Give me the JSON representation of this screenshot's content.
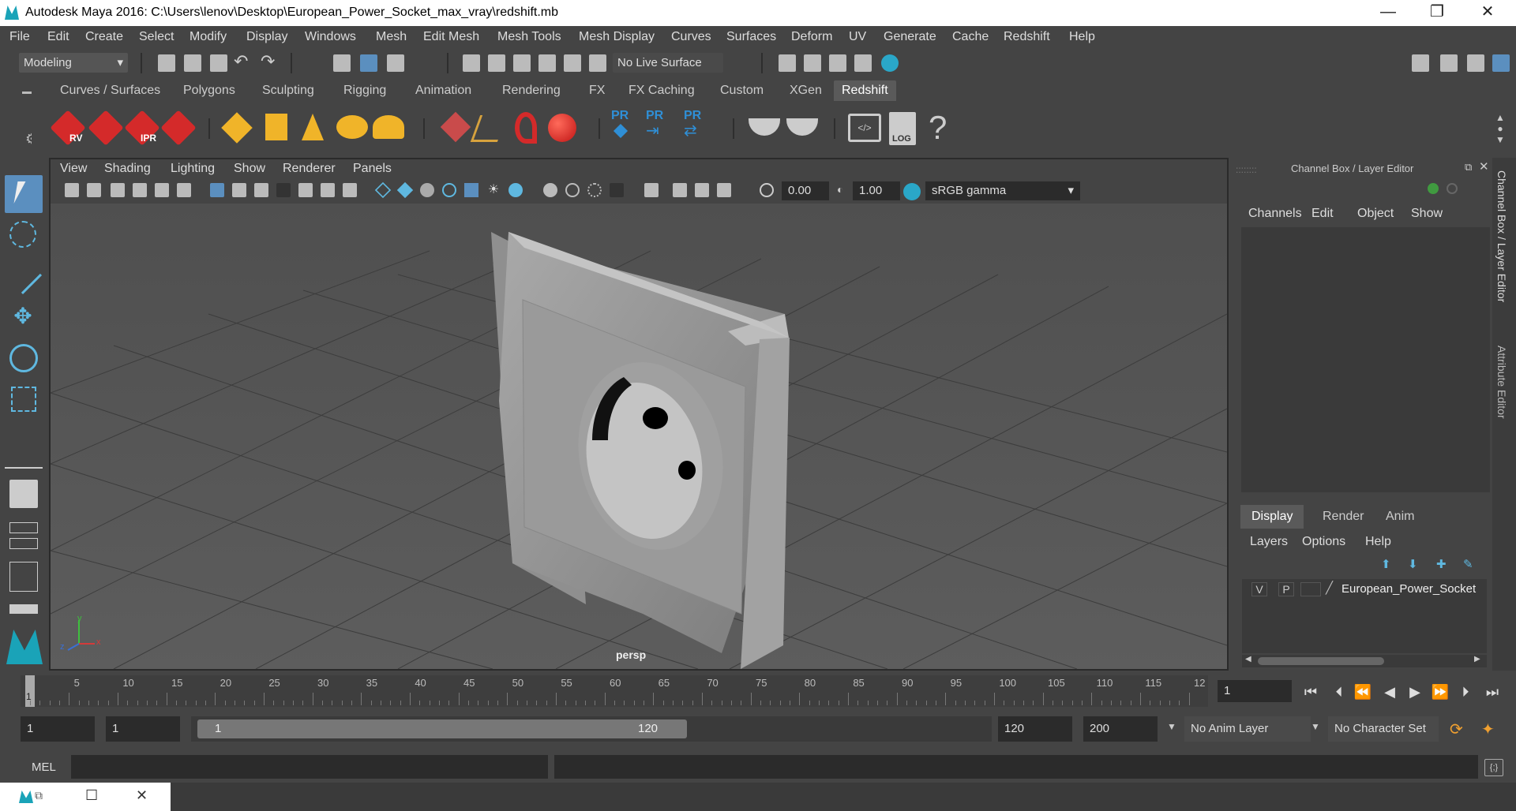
{
  "window": {
    "title": "Autodesk Maya 2016: C:\\Users\\lenov\\Desktop\\European_Power_Socket_max_vray\\redshift.mb",
    "min": "—",
    "max": "❐",
    "close": "✕"
  },
  "menubar": [
    "File",
    "Edit",
    "Create",
    "Select",
    "Modify",
    "Display",
    "Windows",
    "Mesh",
    "Edit Mesh",
    "Mesh Tools",
    "Mesh Display",
    "Curves",
    "Surfaces",
    "Deform",
    "UV",
    "Generate",
    "Cache",
    "Redshift",
    "Help"
  ],
  "statusline": {
    "mode": "Modeling",
    "live_surface": "No Live Surface"
  },
  "shelf_tabs": [
    "Curves / Surfaces",
    "Polygons",
    "Sculpting",
    "Rigging",
    "Animation",
    "Rendering",
    "FX",
    "FX Caching",
    "Custom",
    "XGen",
    "Redshift"
  ],
  "shelf_active": "Redshift",
  "shelf_labels": {
    "rv": "RV",
    "ipr": "IPR",
    "log": "LOG",
    "pr": "PR",
    "help": "?"
  },
  "viewport": {
    "menus": [
      "View",
      "Shading",
      "Lighting",
      "Show",
      "Renderer",
      "Panels"
    ],
    "exposure": "0.00",
    "gamma": "1.00",
    "colorspace": "sRGB gamma",
    "camera": "persp",
    "axis_y": "y",
    "axis_x": "x",
    "axis_z": "z"
  },
  "channel_box": {
    "title": "Channel Box / Layer Editor",
    "menus": [
      "Channels",
      "Edit",
      "Object",
      "Show"
    ]
  },
  "layer_editor": {
    "tabs": [
      "Display",
      "Render",
      "Anim"
    ],
    "active": "Display",
    "menus": [
      "Layers",
      "Options",
      "Help"
    ],
    "layer": {
      "v": "V",
      "p": "P",
      "name": "European_Power_Socket"
    }
  },
  "side_tabs": [
    "Channel Box / Layer Editor",
    "Attribute Editor"
  ],
  "timeline": {
    "ticks": [
      "5",
      "10",
      "15",
      "20",
      "25",
      "30",
      "35",
      "40",
      "45",
      "50",
      "55",
      "60",
      "65",
      "70",
      "75",
      "80",
      "85",
      "90",
      "95",
      "100",
      "105",
      "110",
      "115",
      "12"
    ],
    "start_marker": "1",
    "current": "1"
  },
  "range": {
    "start": "1",
    "playback_start": "1",
    "slider_start": "1",
    "slider_end": "120",
    "playback_end": "120",
    "end": "200",
    "anim_layer": "No Anim Layer",
    "char_set": "No Character Set"
  },
  "cmdline": {
    "label": "MEL"
  },
  "colors": {
    "accent": "#1aa3b8",
    "redshift_red": "#d42a2a",
    "yellow": "#f0b429",
    "pr_blue": "#2f8fd6"
  }
}
